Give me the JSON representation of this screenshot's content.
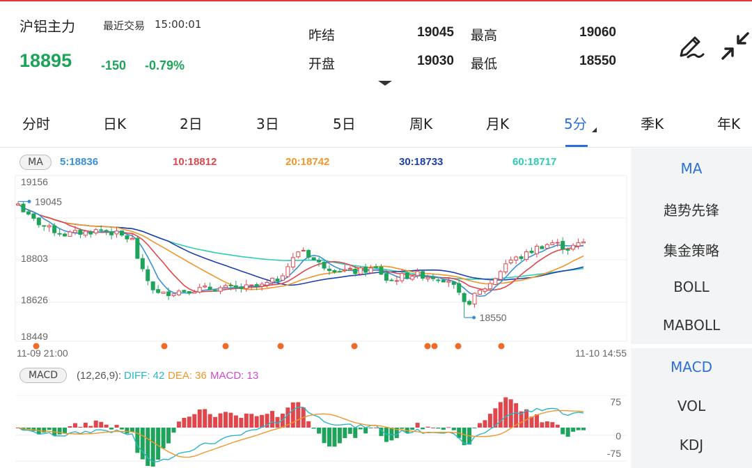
{
  "header": {
    "name": "沪铝主力",
    "recent_label": "最近交易",
    "time": "15:00:01",
    "price": "18895",
    "change": "-150",
    "change_pct": "-0.79%",
    "stats": [
      {
        "label": "昨结",
        "value": "19045"
      },
      {
        "label": "开盘",
        "value": "19030"
      },
      {
        "label": "最高",
        "value": "19060"
      },
      {
        "label": "最低",
        "value": "18550"
      }
    ],
    "icons": [
      "draw-pen-icon",
      "collapse-icon"
    ]
  },
  "tabs": [
    {
      "label": "分时"
    },
    {
      "label": "日K"
    },
    {
      "label": "2日"
    },
    {
      "label": "3日"
    },
    {
      "label": "5日"
    },
    {
      "label": "周K"
    },
    {
      "label": "月K"
    },
    {
      "label": "5分",
      "active": true
    },
    {
      "label": "季K"
    },
    {
      "label": "年K"
    }
  ],
  "ma_bar": {
    "badge": "MA",
    "items": [
      {
        "text": "5:18836",
        "color": "#3a8fd9"
      },
      {
        "text": "10:18812",
        "color": "#e0474c"
      },
      {
        "text": "20:18742",
        "color": "#f0962a"
      },
      {
        "text": "30:18733",
        "color": "#1e3fb0"
      },
      {
        "text": "60:18717",
        "color": "#2ccdb5"
      }
    ]
  },
  "panel_top": [
    {
      "label": "MA",
      "active": true
    },
    {
      "label": "趋势先锋"
    },
    {
      "label": "集金策略"
    },
    {
      "label": "BOLL"
    },
    {
      "label": "MABOLL"
    }
  ],
  "panel_bottom": [
    {
      "label": "MACD",
      "active": true
    },
    {
      "label": "VOL"
    },
    {
      "label": "KDJ"
    }
  ],
  "macd_bar": {
    "badge": "MACD",
    "params": "(12,26,9):",
    "diff": "DIFF: 42",
    "dea": "DEA: 36",
    "macd": "MACD: 13"
  },
  "colors": {
    "up": "#e0474c",
    "down": "#1ea35a",
    "accent": "#2d6fd9",
    "ma5": "#3a8fd9",
    "ma10": "#e0474c",
    "ma20": "#f0962a",
    "ma30": "#1e3fb0",
    "ma60": "#2ccdb5",
    "marker": "#f06a2a"
  },
  "chart_data": {
    "type": "candlestick",
    "y_ticks": [
      "19156",
      "18803",
      "18626",
      "18449"
    ],
    "ylim": [
      18449,
      19156
    ],
    "x_start_label": "11-09 21:00",
    "x_end_label": "11-10 14:55",
    "high_marker": "19045",
    "low_marker": "18550",
    "macd_ticks": [
      "75",
      "0",
      "-75"
    ],
    "macd_ylim": [
      -75,
      75
    ]
  }
}
